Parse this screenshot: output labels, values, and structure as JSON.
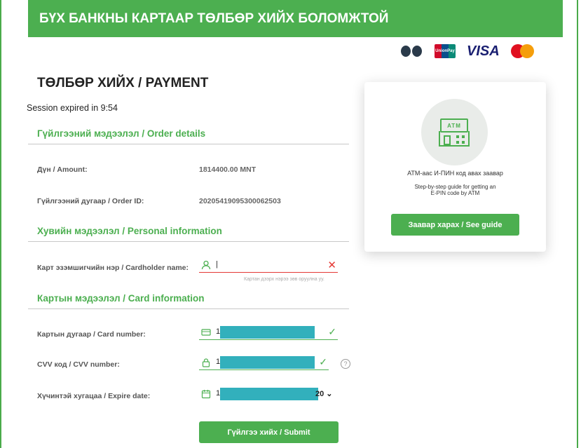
{
  "banner": {
    "title": "БҮХ БАНКНЫ КАРТААР ТӨЛБӨР ХИЙХ БОЛОМЖТОЙ"
  },
  "payment_logos": [
    {
      "icon": "bank-seal-logo"
    },
    {
      "icon": "unionpay-logo",
      "text": "UnionPay"
    },
    {
      "icon": "visa-logo",
      "text": "VISA"
    },
    {
      "icon": "mastercard-logo"
    },
    {
      "icon": "jcb-logo"
    }
  ],
  "page": {
    "title": "ТӨЛБӨР ХИЙХ / PAYMENT",
    "session": "Session expired in 9:54"
  },
  "order": {
    "section_title": "Гүйлгээний мэдээлэл / Order details",
    "amount_label": "Дүн / Amount:",
    "amount_value": "1814400.00 MNT",
    "order_id_label": "Гүйлгээний дугаар / Order ID:",
    "order_id_value": "20205419095300062503"
  },
  "personal": {
    "section_title": "Хувийн мэдээлэл / Personal information",
    "cardholder_label": "Карт эзэмшигчийн нэр / Cardholder name:",
    "cardholder_value": "|",
    "cardholder_hint": "Картан дээрх нэрээ зөв оруулна уу."
  },
  "card": {
    "section_title": "Картын мэдээлэл / Card information",
    "number_label": "Картын дугаар / Card number:",
    "number_value": "1",
    "cvv_label": "CVV код / CVV number:",
    "cvv_value": "1",
    "expire_label": "Хүчинтэй хугацаа / Expire date:",
    "expire_value": "1",
    "expire_year": "20"
  },
  "submit_label": "Гүйлгээ хийх / Submit",
  "atm_card": {
    "screen_text": "ATM",
    "line1": "АТМ-аас И-ПИН код авах заавар",
    "line2": "Step-by-step guide for getting an",
    "line3": "E-PIN code by ATM",
    "button_label": "Заавар харах / See guide"
  },
  "colors": {
    "accent": "#4caf50",
    "error": "#e53935",
    "mask": "#32b0bc"
  }
}
